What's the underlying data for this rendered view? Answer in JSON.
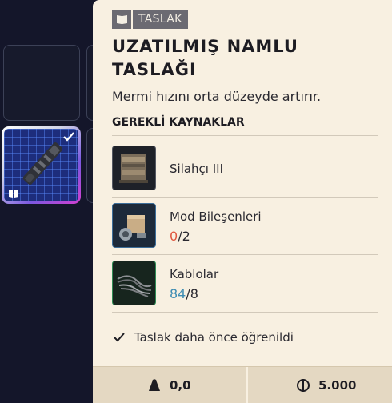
{
  "tag": {
    "label": "TASLAK",
    "icon": "blueprint-icon"
  },
  "item": {
    "title_line1": "UZATILMIŞ NAMLU",
    "title_line2": "TASLAĞI",
    "description": "Mermi hızını orta düzeyde artırır."
  },
  "requirements": {
    "heading": "GEREKLİ KAYNAKLAR",
    "items": [
      {
        "name": "Silahçı III",
        "count": "",
        "have": "",
        "need": ""
      },
      {
        "name": "Mod Bileşenleri",
        "have": "0",
        "need": "/2",
        "have_color": "#e0563e"
      },
      {
        "name": "Kablolar",
        "have": "84",
        "need": "/8",
        "have_color": "#3f8db3"
      }
    ]
  },
  "status": {
    "learned_text": "Taslak daha önce öğrenildi",
    "icon": "checkmark-icon"
  },
  "footer": {
    "weight": "0,0",
    "weight_icon": "weight-icon",
    "price": "5.000",
    "price_icon": "coin-icon"
  },
  "colors": {
    "panel_bg": "#f8f0e1",
    "footer_bg": "#e4d8c2",
    "app_bg": "#14162a",
    "tag_bg": "#6b6a72"
  }
}
